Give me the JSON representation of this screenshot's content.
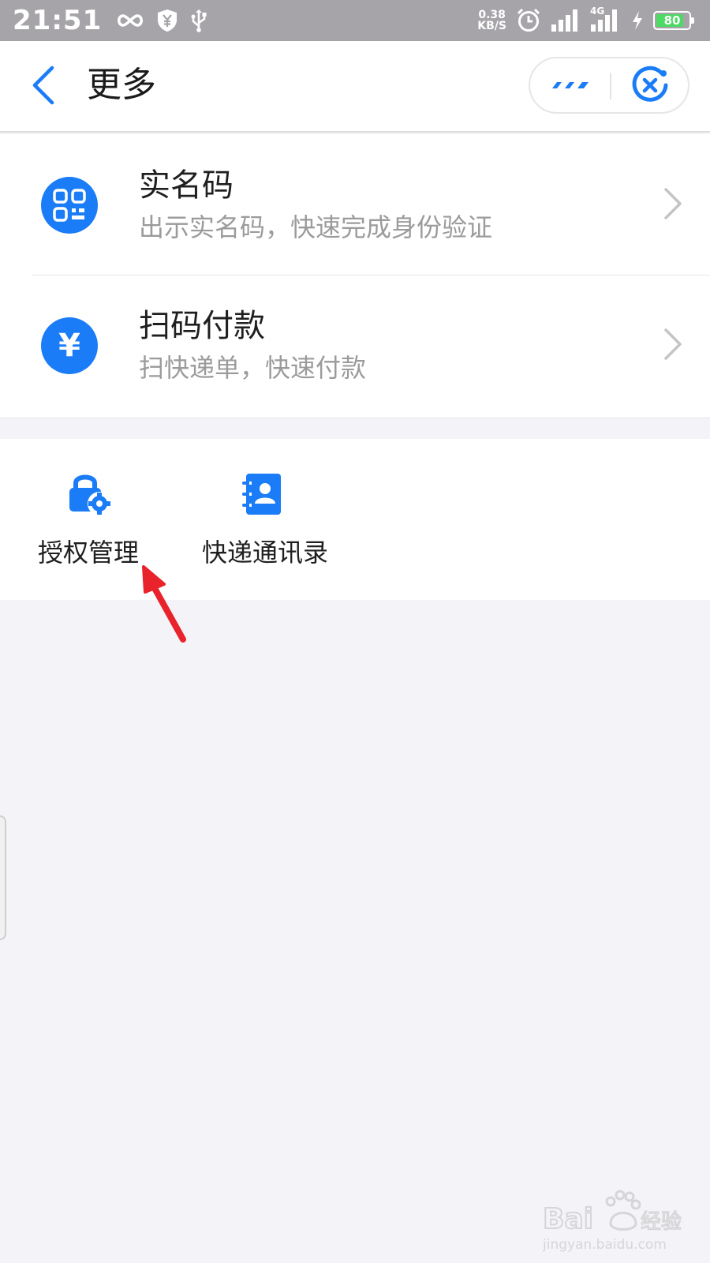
{
  "status_bar": {
    "time": "21:51",
    "net_speed_value": "0.38",
    "net_speed_unit": "KB/S",
    "network_type": "4G",
    "battery_level": "80",
    "icons": [
      "infinity-icon",
      "shield-yen-icon",
      "usb-icon",
      "alarm-icon",
      "signal-icon",
      "signal-4g-icon",
      "charging-icon",
      "battery-icon"
    ]
  },
  "header": {
    "title": "更多",
    "back_icon": "chevron-left-icon",
    "more_icon": "more-dots-icon",
    "close_icon": "target-close-icon"
  },
  "list": [
    {
      "title": "实名码",
      "subtitle": "出示实名码，快速完成身份验证",
      "icon": "qr-code-icon"
    },
    {
      "title": "扫码付款",
      "subtitle": "扫快递单，快速付款",
      "icon": "yen-icon",
      "icon_glyph": "¥"
    }
  ],
  "grid": [
    {
      "label": "授权管理",
      "icon": "lock-gear-icon"
    },
    {
      "label": "快递通讯录",
      "icon": "contacts-book-icon"
    }
  ],
  "watermark": {
    "brand": "Bai",
    "suffix": "经验",
    "url": "jingyan.baidu.com"
  },
  "colors": {
    "accent": "#1a7cf7",
    "status_bar_bg": "#a6a4a8",
    "page_bg": "#f4f3f7",
    "subtitle_text": "#9b9b9b",
    "annotation_arrow": "#e8232b",
    "battery_fill": "#4cd964"
  }
}
